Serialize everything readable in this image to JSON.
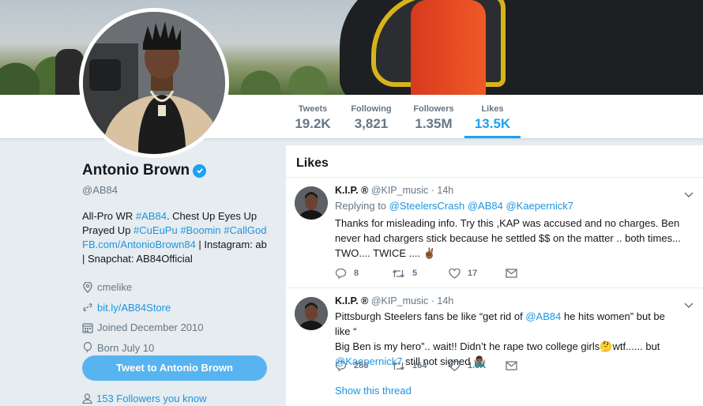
{
  "profile": {
    "name": "Antonio Brown",
    "handle": "@AB84",
    "bio_line1_text": "All-Pro WR ",
    "bio_tag1": "#AB84",
    "bio_line1_rest": ". Chest Up Eyes Up",
    "bio_line2_text": "Prayed Up ",
    "bio_tag2": "#CuEuPu",
    "bio_tag3": "#Boomin",
    "bio_tag4": "#CallGod",
    "bio_link": "FB.com/AntonioBrown84",
    "bio_rest1": " | Instagram: ab",
    "bio_rest2": "| Snapchat: AB84Official",
    "location": "cmelike",
    "website": "bit.ly/AB84Store",
    "joined": "Joined December 2010",
    "born": "Born July 10",
    "tweet_to_label": "Tweet to Antonio Brown",
    "followers_you_know": "153 Followers you know"
  },
  "stats": [
    {
      "label": "Tweets",
      "value": "19.2K"
    },
    {
      "label": "Following",
      "value": "3,821"
    },
    {
      "label": "Followers",
      "value": "1.35M"
    },
    {
      "label": "Likes",
      "value": "13.5K"
    }
  ],
  "colors": {
    "accent": "#1da1f2",
    "link": "#1b95e0",
    "muted": "#657786"
  },
  "timeline": {
    "title": "Likes",
    "tweets": [
      {
        "name": "K.I.P. ®",
        "handle": "@KIP_music",
        "time": "· 14h",
        "replying_prefix": "Replying to ",
        "replying_to": [
          "@SteelersCrash",
          "@AB84",
          "@Kaepernick7"
        ],
        "text1": "Thanks for misleading info. Try this ,KAP was accused and no charges. Ben",
        "text2": "never had chargers stick because he settled $$ on the matter .. both times...",
        "text3": "TWO.... TWICE .... ",
        "emoji": "✌🏾",
        "replies": "8",
        "retweets": "5",
        "likes": "17"
      },
      {
        "name": "K.I.P. ®",
        "handle": "@KIP_music",
        "time": "· 14h",
        "text1a": "Pittsburgh Steelers fans be like “get rid of ",
        "text1_mention": "@AB84",
        "text1b": " he hits women” but be like “",
        "text2a": "Big Ben is my hero”.. wait!! Didn’t he rape two college girls",
        "emoji_think": "🤔",
        "text2b": "wtf...... but",
        "text3_mention": "@Kaepernick7",
        "text3b": " still not signed ",
        "emoji_shrug": "🤷🏾‍♂️",
        "replies": "286",
        "retweets": "164",
        "likes": "1.0K",
        "show_thread": "Show this thread"
      }
    ]
  }
}
